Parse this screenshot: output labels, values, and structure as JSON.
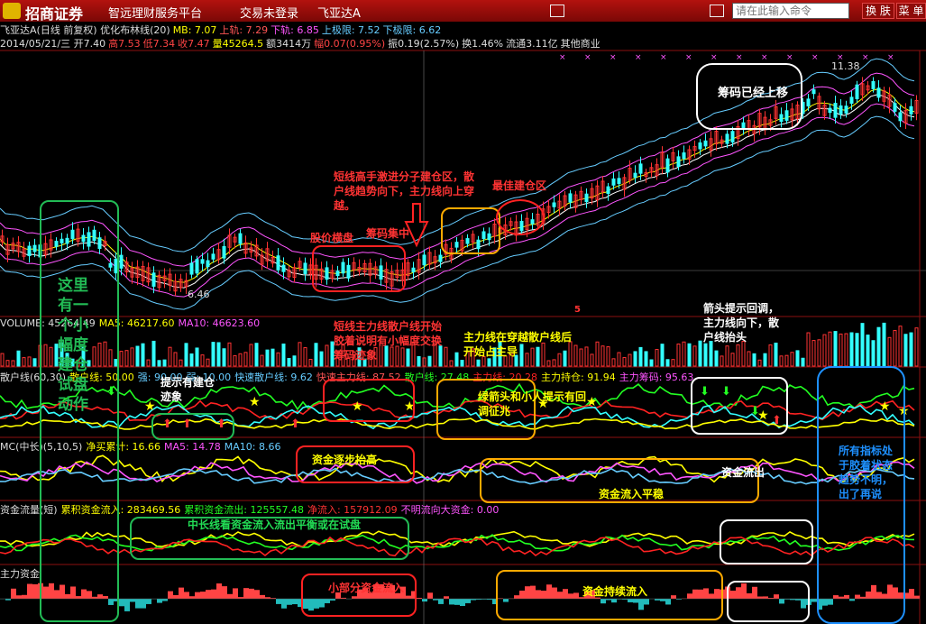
{
  "titlebar": {
    "logo": "招商证券",
    "app_name": "智远理财服务平台",
    "login_status": "交易未登录",
    "stock_tab": "飞亚达A",
    "search_placeholder": "请在此输入命令",
    "switch_button": "换 肤",
    "menu_button": "菜 单"
  },
  "price_panel": {
    "header": [
      "飞亚达A(日线 前复权) 优化布林线(20)",
      "MB: 7.07",
      "上轨: 7.29",
      "下轨: 6.85",
      "上极限: 7.52",
      "下极限: 6.62"
    ],
    "quote": [
      "2014/05/21/三 开7.40",
      "高7.53",
      "低7.34",
      "收7.47",
      "量45264.5",
      "额3414万",
      "幅0.07(0.95%)",
      "振0.19(2.57%)",
      "换1.46%",
      "流通3.11亿",
      "其他商业"
    ],
    "high_label": "11.38",
    "low_label": "6.46"
  },
  "volume_panel": [
    "VOLUME: 45264.49",
    "MA5: 46217.60",
    "MA10: 46623.60"
  ],
  "retail_panel": [
    "散户线(60,30)",
    "散户线: 50.00",
    "强: 90.00",
    "弱: 10.00",
    "快速散户线: 9.62",
    "快速主力线: 87.52",
    "散户线: 27.48",
    "主力线: 20.28",
    "主力持仓: 91.94",
    "主力筹码: 95.63"
  ],
  "mc_panel": [
    "MC(中长)(5,10,5)",
    "净买累计: 16.66",
    "MA5: 14.78",
    "MA10: 8.66"
  ],
  "flow_panel": [
    "资金流量(短)",
    "累积资金流入: 283469.56",
    "累积资金流出: 125557.48",
    "净流入: 157912.09",
    "不明流向大资金: 0.00"
  ],
  "main_fund_panel": [
    "主力资金"
  ],
  "annotations": {
    "green_left": "这里有一个小幅度建仓试盘动作",
    "price_consolidation": "股价横盘",
    "chip_concentration": "筹码集中",
    "short_term_hint": "短线高手激进分子建仓区，散户线趋势向下，主力线向上穿越。",
    "best_entry": "最佳建仓区",
    "chips_moved_up": "筹码已经上移",
    "arrow_hint": "箭头提示回调，主力线向下，散户线抬头",
    "lines_crossing": "短线主力线散户线开始胶着说明有小幅度交换筹码迹象",
    "main_cross": "主力线在穿越散户线后开始占主导",
    "build_hint": "提示有建仓迹象",
    "green_arrow_hint": "绿箭头和小人提示有回调征兆",
    "fund_rising": "资金逐步抬高",
    "fund_steady": "资金流入平稳",
    "fund_outflow": "资金流出",
    "all_indicators": "所有指标处于胶着状态趋势不明，出了再说",
    "long_balance": "中长线看资金流入流出平衡或在试盘",
    "small_inflow": "小部分资金流入",
    "continuous_inflow": "资金持续流入",
    "mid_marker": "5"
  },
  "colors": {
    "up": "#ff3333",
    "down": "#33ffff",
    "yellow": "#ffff00",
    "green_box": "#22bb55",
    "red_box": "#ff2222",
    "orange_box": "#ffaa00",
    "white_box": "#ffffff",
    "blue_box": "#1e90ff"
  }
}
